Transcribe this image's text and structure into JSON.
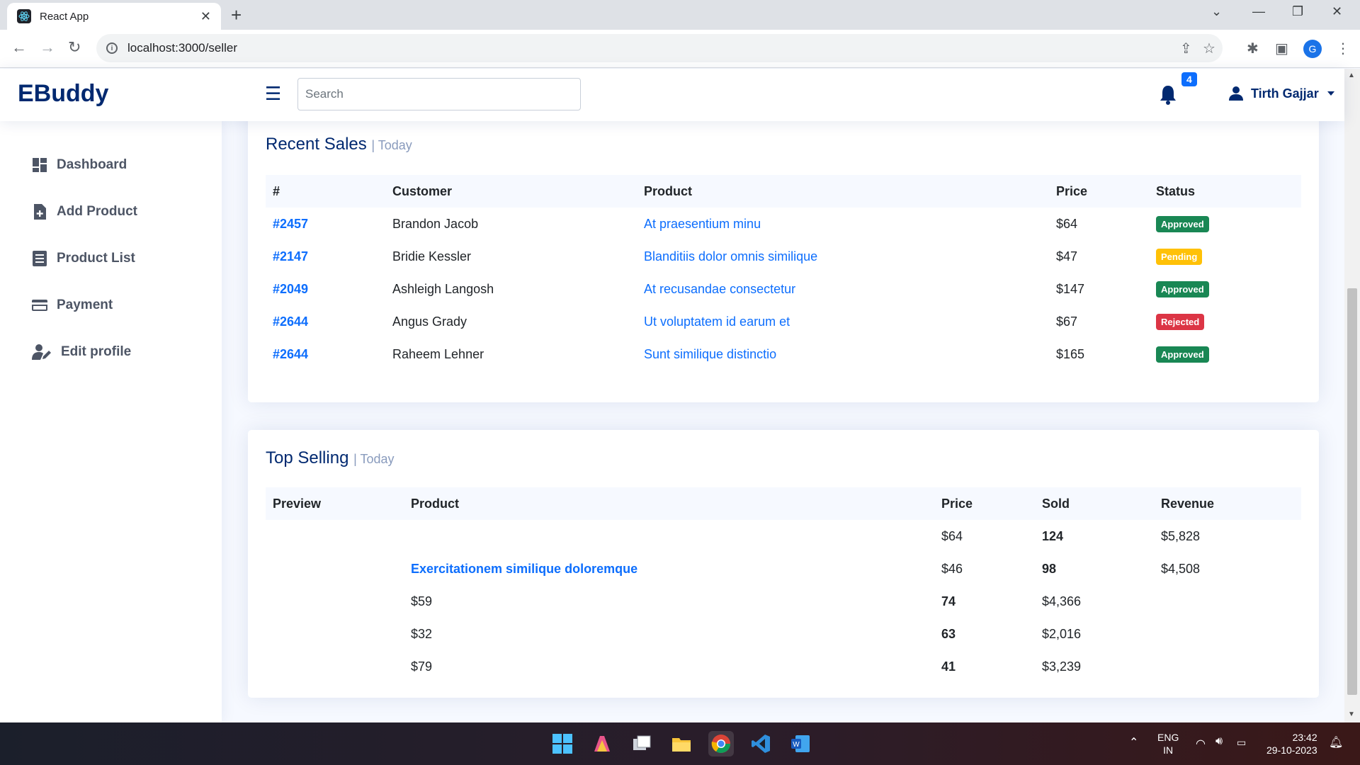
{
  "browser": {
    "tab_title": "React App",
    "url": "localhost:3000/seller",
    "profile_initial": "G"
  },
  "header": {
    "logo": "EBuddy",
    "search_placeholder": "Search",
    "notification_count": "4",
    "user_name": "Tirth Gajjar"
  },
  "sidebar": {
    "items": [
      {
        "label": "Dashboard",
        "icon": "dashboard-icon"
      },
      {
        "label": "Add Product",
        "icon": "file-plus-icon"
      },
      {
        "label": "Product List",
        "icon": "list-icon"
      },
      {
        "label": "Payment",
        "icon": "credit-card-icon"
      },
      {
        "label": "Edit profile",
        "icon": "user-edit-icon"
      }
    ]
  },
  "recent_sales": {
    "title": "Recent Sales",
    "subtitle": "| Today",
    "columns": [
      "#",
      "Customer",
      "Product",
      "Price",
      "Status"
    ],
    "rows": [
      {
        "id": "#2457",
        "customer": "Brandon Jacob",
        "product": "At praesentium minu",
        "price": "$64",
        "status": "Approved"
      },
      {
        "id": "#2147",
        "customer": "Bridie Kessler",
        "product": "Blanditiis dolor omnis similique",
        "price": "$47",
        "status": "Pending"
      },
      {
        "id": "#2049",
        "customer": "Ashleigh Langosh",
        "product": "At recusandae consectetur",
        "price": "$147",
        "status": "Approved"
      },
      {
        "id": "#2644",
        "customer": "Angus Grady",
        "product": "Ut voluptatem id earum et",
        "price": "$67",
        "status": "Rejected"
      },
      {
        "id": "#2644",
        "customer": "Raheem Lehner",
        "product": "Sunt similique distinctio",
        "price": "$165",
        "status": "Approved"
      }
    ]
  },
  "status_colors": {
    "Approved": "#198754",
    "Pending": "#ffc107",
    "Rejected": "#dc3545"
  },
  "top_selling": {
    "title": "Top Selling",
    "subtitle": "| Today",
    "columns": [
      "Preview",
      "Product",
      "Price",
      "Sold",
      "Revenue"
    ],
    "rows": [
      {
        "c0": "",
        "c1": "",
        "c2": "$64",
        "c3": "124",
        "c4": "$5,828"
      },
      {
        "c0": "",
        "c1": "Exercitationem similique doloremque",
        "c2": "$46",
        "c3": "98",
        "c4": "$4,508"
      },
      {
        "c0": "",
        "c1": "$59",
        "c2": "74",
        "c3": "$4,366",
        "c4": ""
      },
      {
        "c0": "",
        "c1": "$32",
        "c2": "63",
        "c3": "$2,016",
        "c4": ""
      },
      {
        "c0": "",
        "c1": "$79",
        "c2": "41",
        "c3": "$3,239",
        "c4": ""
      }
    ]
  },
  "taskbar": {
    "lang_line1": "ENG",
    "lang_line2": "IN",
    "time": "23:42",
    "date": "29-10-2023"
  }
}
